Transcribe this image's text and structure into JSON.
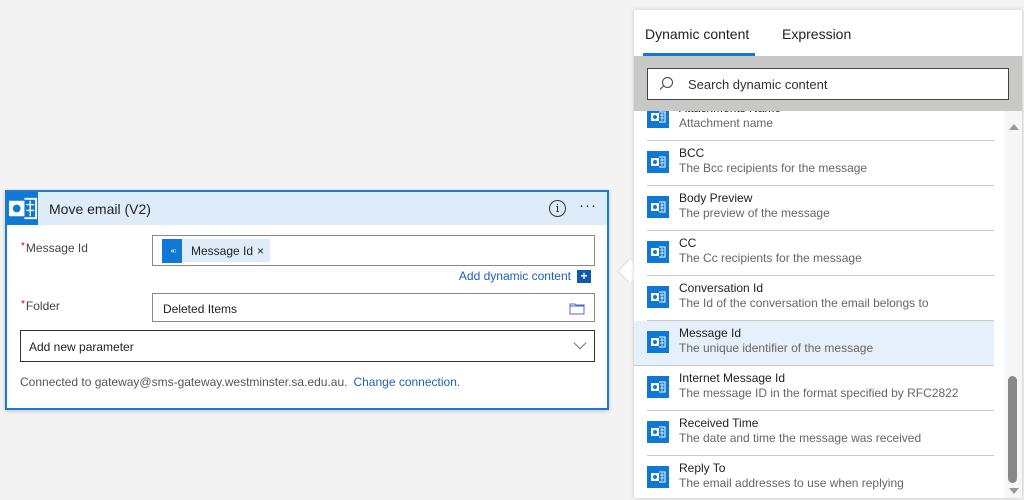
{
  "action_card": {
    "title": "Move email (V2)",
    "info_icon": "i",
    "more_icon": "···",
    "fields": {
      "message_id": {
        "label": "Message Id",
        "required_mark": "*",
        "token": "Message Id",
        "token_remove": "×"
      },
      "add_dynamic_content": "Add dynamic content",
      "add_dynamic_plus": "+",
      "folder": {
        "label": "Folder",
        "required_mark": "*",
        "value": "Deleted Items"
      }
    },
    "add_parameter": "Add new parameter",
    "connection_text": "Connected to gateway@sms-gateway.westminster.sa.edu.au.",
    "change_connection": "Change connection."
  },
  "panel": {
    "tabs": [
      {
        "label": "Dynamic content",
        "active": true
      },
      {
        "label": "Expression",
        "active": false
      }
    ],
    "search_placeholder": "Search dynamic content",
    "items": [
      {
        "title": "Attachments Name",
        "desc": "Attachment name"
      },
      {
        "title": "BCC",
        "desc": "The Bcc recipients for the message"
      },
      {
        "title": "Body Preview",
        "desc": "The preview of the message"
      },
      {
        "title": "CC",
        "desc": "The Cc recipients for the message"
      },
      {
        "title": "Conversation Id",
        "desc": "The Id of the conversation the email belongs to"
      },
      {
        "title": "Message Id",
        "desc": "The unique identifier of the message",
        "selected": true
      },
      {
        "title": "Internet Message Id",
        "desc": "The message ID in the format specified by RFC2822"
      },
      {
        "title": "Received Time",
        "desc": "The date and time the message was received"
      },
      {
        "title": "Reply To",
        "desc": "The email addresses to use when replying"
      }
    ]
  },
  "colors": {
    "accent": "#0f78d4",
    "header_bg": "#deebf8",
    "selected_bg": "#e6f0fb"
  }
}
